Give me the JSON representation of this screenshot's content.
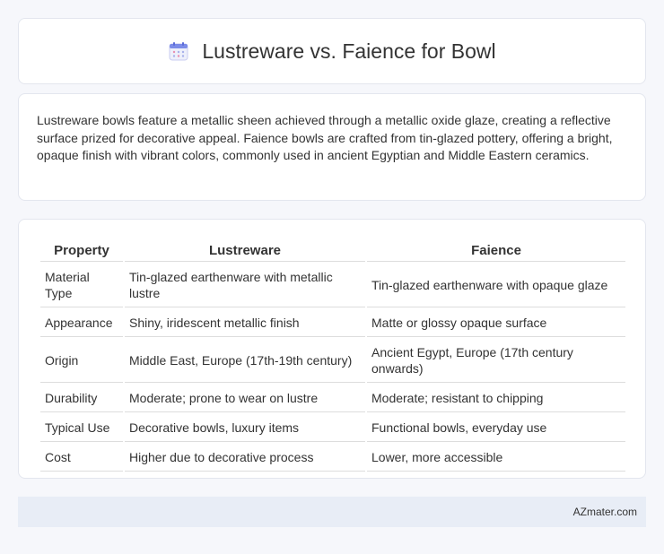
{
  "header": {
    "title": "Lustreware vs. Faience for Bowl",
    "icon": "calendar-icon"
  },
  "intro": {
    "text": "Lustreware bowls feature a metallic sheen achieved through a metallic oxide glaze, creating a reflective surface prized for decorative appeal. Faience bowls are crafted from tin-glazed pottery, offering a bright, opaque finish with vibrant colors, commonly used in ancient Egyptian and Middle Eastern ceramics."
  },
  "table": {
    "headers": [
      "Property",
      "Lustreware",
      "Faience"
    ],
    "rows": [
      [
        "Material Type",
        "Tin-glazed earthenware with metallic lustre",
        "Tin-glazed earthenware with opaque glaze"
      ],
      [
        "Appearance",
        "Shiny, iridescent metallic finish",
        "Matte or glossy opaque surface"
      ],
      [
        "Origin",
        "Middle East, Europe (17th-19th century)",
        "Ancient Egypt, Europe (17th century onwards)"
      ],
      [
        "Durability",
        "Moderate; prone to wear on lustre",
        "Moderate; resistant to chipping"
      ],
      [
        "Typical Use",
        "Decorative bowls, luxury items",
        "Functional bowls, everyday use"
      ],
      [
        "Cost",
        "Higher due to decorative process",
        "Lower, more accessible"
      ]
    ]
  },
  "footer": {
    "brand": "AZmater.com"
  }
}
